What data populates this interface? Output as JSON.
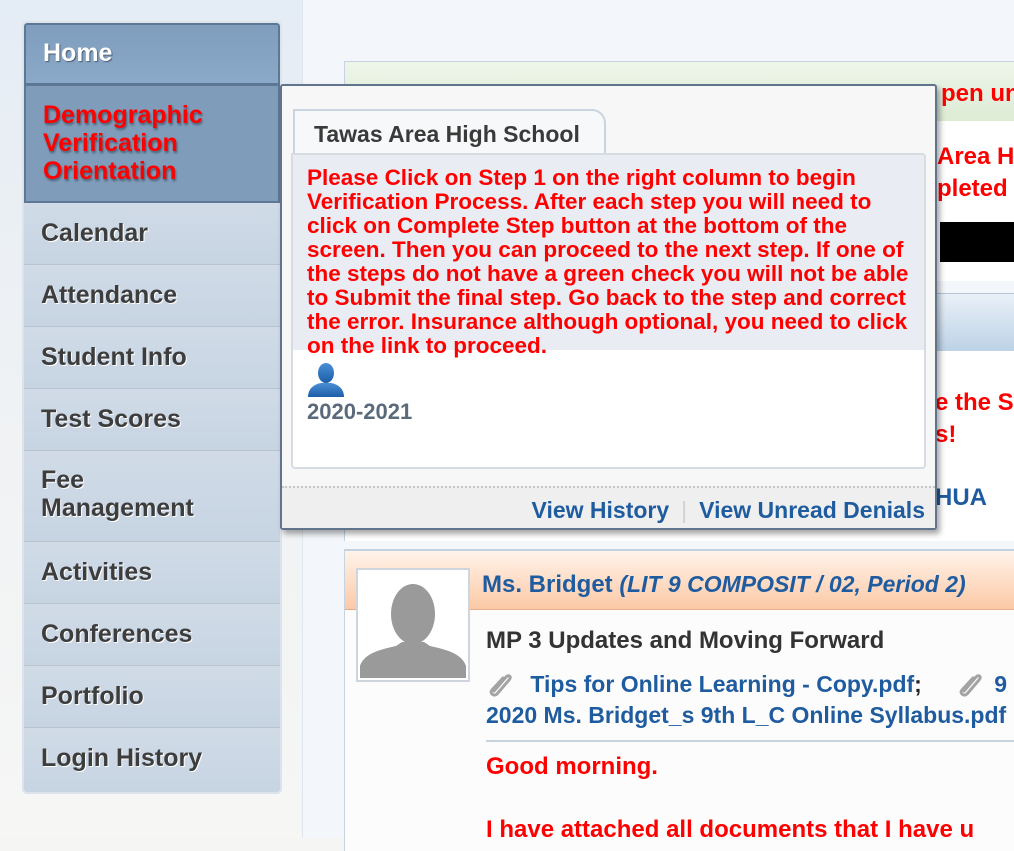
{
  "sidebar": {
    "items": [
      {
        "label": "Home",
        "state": "home"
      },
      {
        "label": "Demographic Verification Orientation",
        "state": "active"
      },
      {
        "label": "Calendar"
      },
      {
        "label": "Attendance"
      },
      {
        "label": "Student Info"
      },
      {
        "label": "Test Scores"
      },
      {
        "label": "Fee Management"
      },
      {
        "label": "Activities"
      },
      {
        "label": "Conferences"
      },
      {
        "label": "Portfolio"
      },
      {
        "label": "Login History"
      }
    ]
  },
  "background": {
    "banner_partial": "pen unt",
    "school_partial_1": "Area H",
    "school_partial_2": "pleted",
    "message_partial_1": "e the S",
    "message_partial_2": "s!",
    "link_partial": "HUA"
  },
  "popup": {
    "tab_label": "Tawas Area High School",
    "message": "Please Click on Step 1 on the right column to begin Verification Process. After each step you will need to click on Complete Step button at the bottom of the screen. Then you can proceed to the next step. If one of the steps do not have a green check you will not be able to Submit the final step. Go back to the step and correct the error. Insurance although optional, you need to click on the link to proceed.",
    "year": "2020-2021",
    "view_history": "View History",
    "separator": "|",
    "view_unread_denials": "View Unread Denials"
  },
  "post": {
    "teacher": "Ms. Bridget",
    "course": "(LIT 9 COMPOSIT / 02, Period 2)",
    "title": "MP 3 Updates and Moving Forward",
    "attachment_1": "Tips for Online Learning - Copy.pdf",
    "attachment_sep": ";",
    "attachment_2_partial": "9",
    "attachment_2_line2": "2020 Ms. Bridget_s 9th L_C Online Syllabus.pdf",
    "greeting": "Good morning.",
    "body_partial": "I have attached all documents that I have u"
  },
  "colors": {
    "accent_red": "#ff0000",
    "link_blue": "#1f5c9f",
    "nav_active_bg": "#7f9dbb"
  }
}
